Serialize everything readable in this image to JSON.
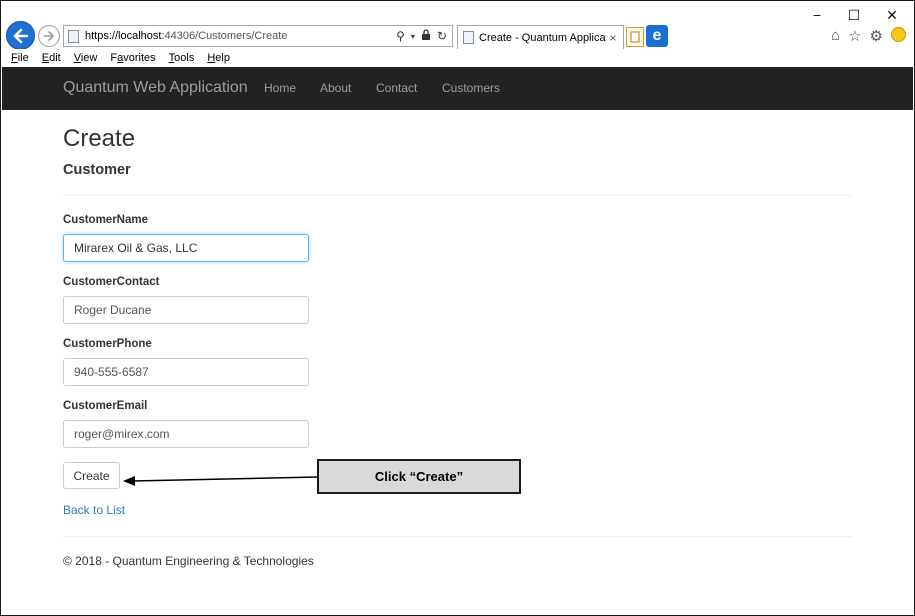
{
  "browser": {
    "url_host": "https://localhost",
    "url_path": ":44306/Customers/Create",
    "tab_title": "Create - Quantum Applicati",
    "tab_close": "×",
    "menu": [
      {
        "accel": "F",
        "rest": "ile"
      },
      {
        "accel": "E",
        "rest": "dit"
      },
      {
        "accel": "V",
        "rest": "iew"
      },
      {
        "prefix": "F",
        "accel": "a",
        "rest": "vorites"
      },
      {
        "accel": "T",
        "rest": "ools"
      },
      {
        "accel": "H",
        "rest": "elp"
      }
    ],
    "window": {
      "minimize": "−",
      "maximize": "☐",
      "close": "✕"
    },
    "edge_glyph": "e"
  },
  "site": {
    "brand": "Quantum Web Application",
    "nav": {
      "home": "Home",
      "about": "About",
      "contact": "Contact",
      "customers": "Customers"
    }
  },
  "page": {
    "title": "Create",
    "subtitle": "Customer"
  },
  "form": {
    "name_label": "CustomerName",
    "name_value": "Mirarex Oil & Gas, LLC",
    "contact_label": "CustomerContact",
    "contact_value": "Roger Ducane",
    "phone_label": "CustomerPhone",
    "phone_value": "940-555-6587",
    "email_label": "CustomerEmail",
    "email_value": "roger@mirex.com",
    "submit_label": "Create"
  },
  "links": {
    "back": "Back to List"
  },
  "footer": {
    "text": "© 2018 - Quantum Engineering & Technologies"
  },
  "callout": {
    "text": "Click “Create”"
  },
  "colors": {
    "navbar": "#222222",
    "link": "#337ab7",
    "focus": "#66afe9",
    "callout_bg": "#d9d9d9"
  }
}
